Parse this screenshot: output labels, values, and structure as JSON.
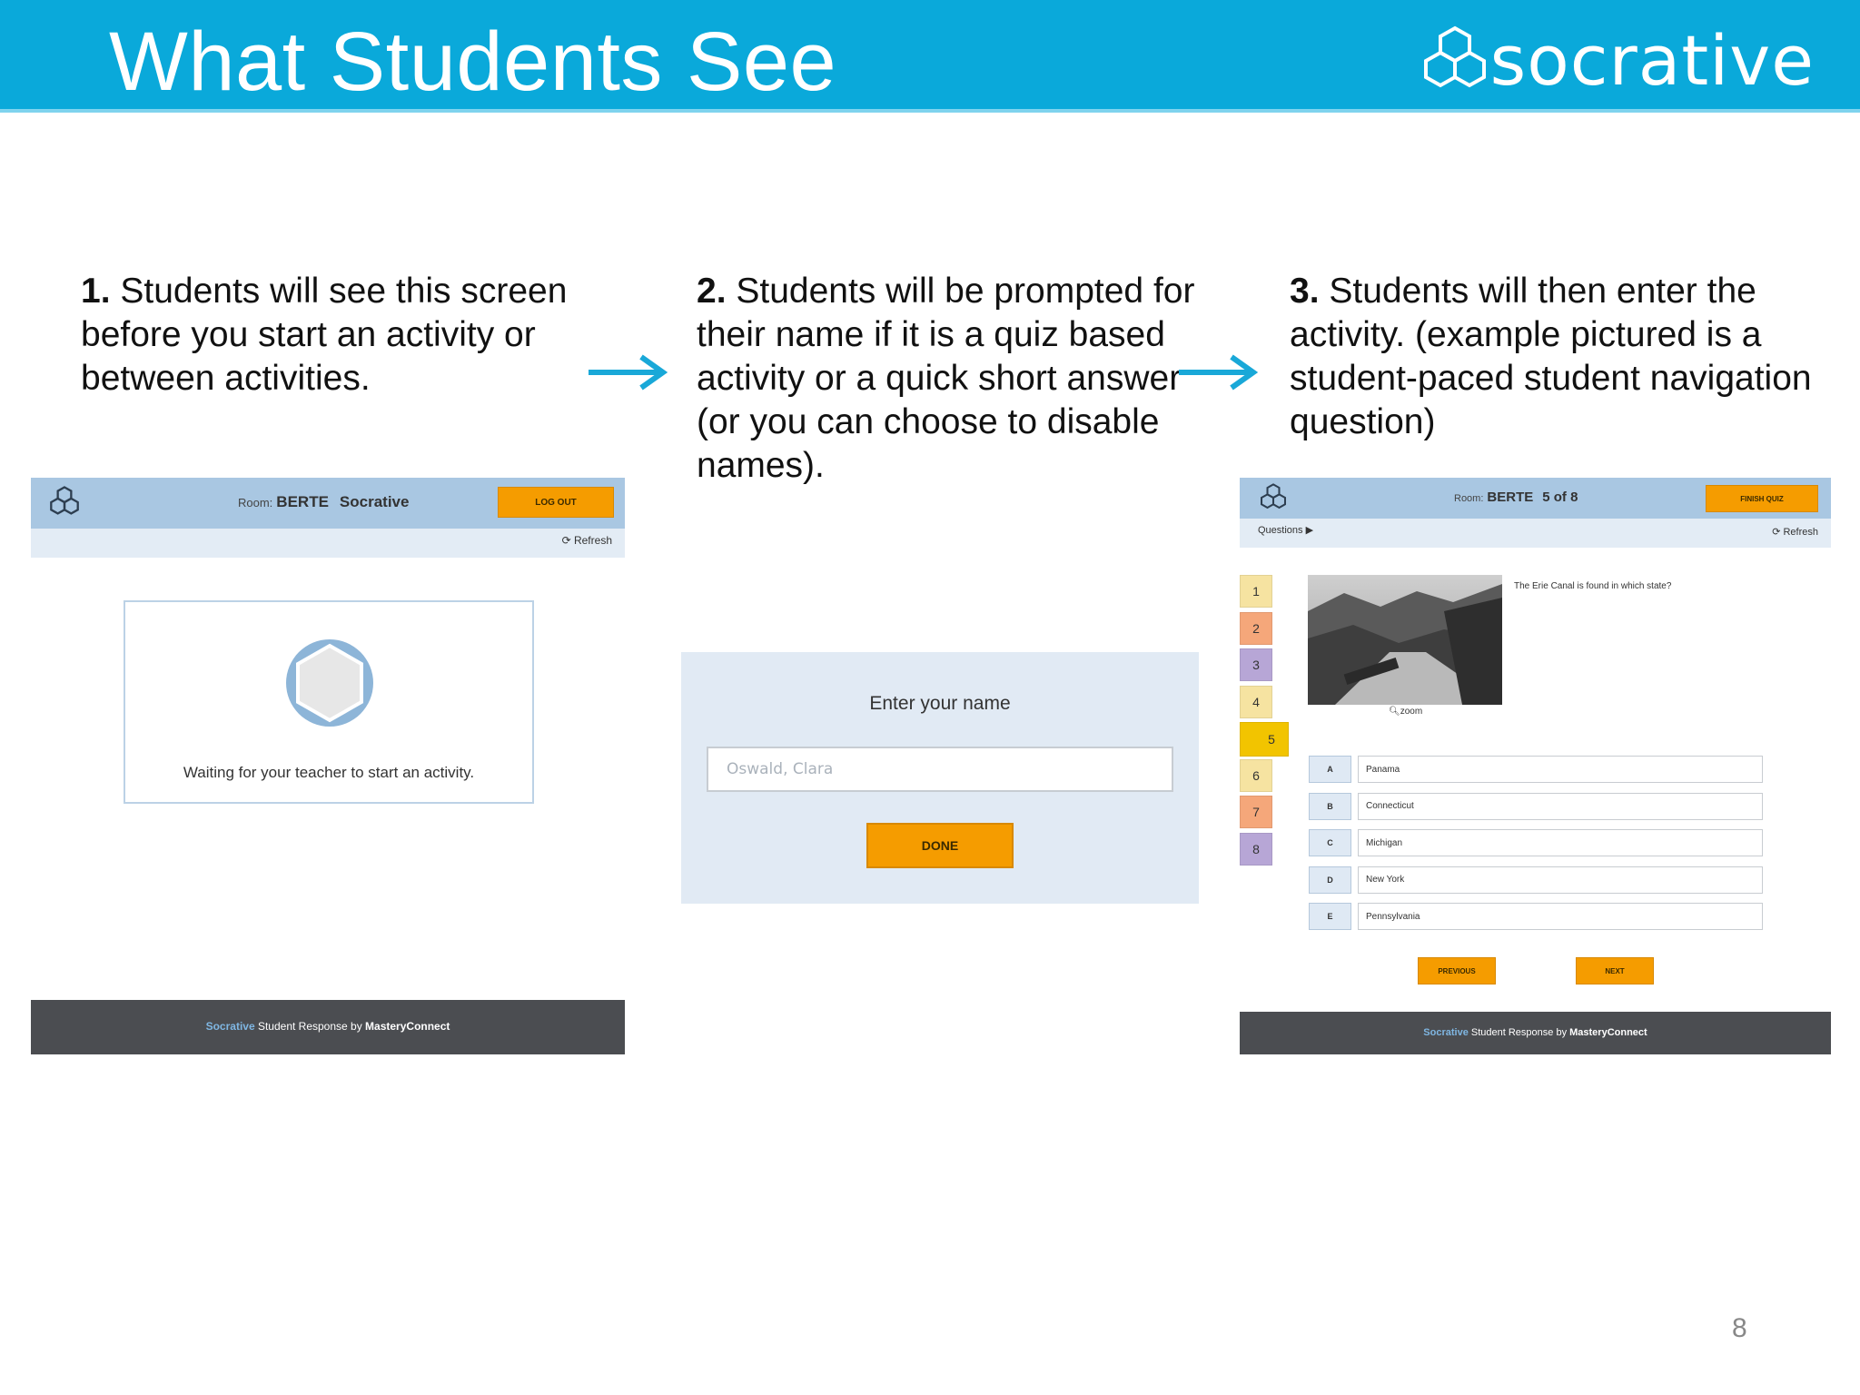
{
  "slide": {
    "title": "What Students See",
    "brand": "socrative",
    "page_number": "8"
  },
  "steps": [
    {
      "number": "1.",
      "text": " Students will see this screen before you start an activity or between activities."
    },
    {
      "number": "2.",
      "text": " Students will be prompted for their name if it is a quiz based activity or a quick short answer (or you can choose to disable names)."
    },
    {
      "number": "3.",
      "text": " Students will then enter the activity. (example pictured is a student-paced student navigation question)"
    }
  ],
  "screen1": {
    "room_label": "Room:",
    "room_value": "BERTE",
    "room_name": "Socrative",
    "logout_label": "LOG OUT",
    "refresh_label": "Refresh",
    "waiting_text": "Waiting for your teacher to start an activity.",
    "footer": {
      "part1": "Socrative",
      "part2": " Student Response by ",
      "part3": "MasteryConnect"
    }
  },
  "screen2": {
    "prompt": "Enter your name",
    "name_value": "Oswald, Clara",
    "done_label": "DONE"
  },
  "screen3": {
    "room_label": "Room:",
    "room_value": "BERTE",
    "progress": "5 of 8",
    "finish_label": "FINISH QUIZ",
    "questions_label": "Questions ▶",
    "refresh_label": "Refresh",
    "question_numbers": [
      "1",
      "2",
      "3",
      "4",
      "5",
      "6",
      "7",
      "8"
    ],
    "current_question": 5,
    "question_colors": [
      "#f6e3a1",
      "#f5a77a",
      "#b7a6d6",
      "#f6e3a1",
      "#f2c400",
      "#f6e3a1",
      "#f5a77a",
      "#b7a6d6"
    ],
    "zoom_label": "zoom",
    "question_text": "The Erie Canal is found in which state?",
    "options": [
      {
        "letter": "A",
        "text": "Panama"
      },
      {
        "letter": "B",
        "text": "Connecticut"
      },
      {
        "letter": "C",
        "text": "Michigan"
      },
      {
        "letter": "D",
        "text": "New York"
      },
      {
        "letter": "E",
        "text": "Pennsylvania"
      }
    ],
    "previous_label": "PREVIOUS",
    "next_label": "NEXT",
    "footer": {
      "part1": "Socrative",
      "part2": " Student Response by ",
      "part3": "MasteryConnect"
    }
  },
  "colors": {
    "header_bg": "#0aa9da",
    "topbar": "#a9c7e2",
    "accent_orange": "#f59c00",
    "arrow": "#19a8d8",
    "footer_bg": "#4b4d51"
  }
}
